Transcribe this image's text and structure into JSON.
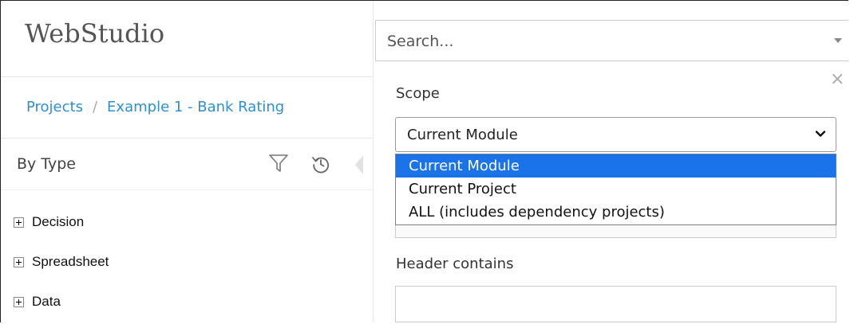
{
  "app": {
    "title": "WebStudio"
  },
  "breadcrumb": {
    "projects_label": "Projects",
    "separator": "/",
    "project_label": "Example 1 - Bank Rating"
  },
  "tree_panel": {
    "view_label": "By Type",
    "items": [
      {
        "label": "Decision"
      },
      {
        "label": "Spreadsheet"
      },
      {
        "label": "Data"
      }
    ]
  },
  "search": {
    "placeholder": "Search..."
  },
  "search_panel": {
    "scope_label": "Scope",
    "scope_selected": "Current Module",
    "scope_options": [
      {
        "label": "Current Module",
        "selected": true
      },
      {
        "label": "Current Project",
        "selected": false
      },
      {
        "label": "ALL (includes dependency projects)",
        "selected": false
      }
    ],
    "header_contains_label": "Header contains",
    "header_contains_value": ""
  },
  "colors": {
    "link": "#2f8fcf",
    "selected_option_bg": "#1a73e8",
    "selected_option_text": "#ffffff"
  }
}
